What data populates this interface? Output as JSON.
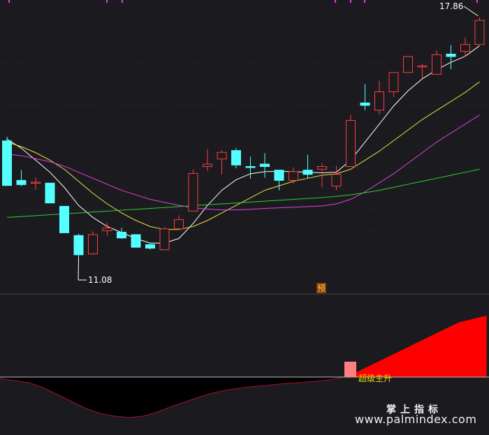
{
  "chart_data": {
    "type": "candlestick",
    "candles": [
      {
        "o": 14.94,
        "h": 15.08,
        "l": 13.46,
        "c": 13.46
      },
      {
        "o": 13.63,
        "h": 13.97,
        "l": 13.44,
        "c": 13.49
      },
      {
        "o": 13.57,
        "h": 13.72,
        "l": 13.32,
        "c": 13.57
      },
      {
        "o": 13.54,
        "h": 13.54,
        "l": 12.88,
        "c": 12.88
      },
      {
        "o": 12.77,
        "h": 12.77,
        "l": 11.89,
        "c": 11.89
      },
      {
        "o": 11.8,
        "h": 11.86,
        "l": 11.08,
        "c": 11.16
      },
      {
        "o": 11.19,
        "h": 11.94,
        "l": 11.16,
        "c": 11.83
      },
      {
        "o": 11.96,
        "h": 12.22,
        "l": 11.8,
        "c": 12.05
      },
      {
        "o": 11.91,
        "h": 12.05,
        "l": 11.69,
        "c": 11.72
      },
      {
        "o": 11.83,
        "h": 11.83,
        "l": 11.41,
        "c": 11.41
      },
      {
        "o": 11.5,
        "h": 11.53,
        "l": 11.33,
        "c": 11.38
      },
      {
        "o": 11.33,
        "h": 12.08,
        "l": 11.33,
        "c": 12.02
      },
      {
        "o": 12.02,
        "h": 12.47,
        "l": 12.0,
        "c": 12.33
      },
      {
        "o": 12.61,
        "h": 13.99,
        "l": 12.61,
        "c": 13.86
      },
      {
        "o": 14.09,
        "h": 14.67,
        "l": 13.94,
        "c": 14.17
      },
      {
        "o": 14.34,
        "h": 14.64,
        "l": 13.83,
        "c": 14.56
      },
      {
        "o": 14.62,
        "h": 14.7,
        "l": 14.03,
        "c": 14.14
      },
      {
        "o": 14.09,
        "h": 14.42,
        "l": 13.69,
        "c": 14.06
      },
      {
        "o": 14.17,
        "h": 14.53,
        "l": 13.72,
        "c": 14.09
      },
      {
        "o": 13.97,
        "h": 13.97,
        "l": 13.3,
        "c": 13.63
      },
      {
        "o": 13.63,
        "h": 14.06,
        "l": 13.52,
        "c": 13.92
      },
      {
        "o": 13.97,
        "h": 14.48,
        "l": 13.69,
        "c": 13.83
      },
      {
        "o": 14.0,
        "h": 14.2,
        "l": 13.41,
        "c": 14.09
      },
      {
        "o": 13.44,
        "h": 14.12,
        "l": 13.3,
        "c": 13.83
      },
      {
        "o": 14.09,
        "h": 15.8,
        "l": 14.09,
        "c": 15.62
      },
      {
        "o": 16.2,
        "h": 16.82,
        "l": 15.96,
        "c": 16.12
      },
      {
        "o": 15.96,
        "h": 16.93,
        "l": 15.82,
        "c": 16.57
      },
      {
        "o": 16.57,
        "h": 17.21,
        "l": 16.4,
        "c": 17.21
      },
      {
        "o": 17.21,
        "h": 17.62,
        "l": 17.21,
        "c": 17.74
      },
      {
        "o": 17.43,
        "h": 17.49,
        "l": 17.01,
        "c": 17.43
      },
      {
        "o": 17.15,
        "h": 17.95,
        "l": 17.15,
        "c": 17.8
      },
      {
        "o": 17.82,
        "h": 18.12,
        "l": 17.32,
        "c": 17.74
      },
      {
        "o": 17.91,
        "h": 18.37,
        "l": 17.74,
        "c": 18.14
      },
      {
        "o": 18.14,
        "h": 19.04,
        "l": 18.14,
        "c": 18.94
      }
    ],
    "ma_lines": [
      {
        "color": "#ffffff",
        "values": [
          15.0,
          14.7,
          14.3,
          13.9,
          13.4,
          12.8,
          12.4,
          12.1,
          11.9,
          11.7,
          11.55,
          11.55,
          11.7,
          12.2,
          12.8,
          13.3,
          13.65,
          13.85,
          13.92,
          13.93,
          13.92,
          13.9,
          13.88,
          13.9,
          14.3,
          14.9,
          15.5,
          16.1,
          16.6,
          17.0,
          17.3,
          17.55,
          17.75,
          18.1
        ]
      },
      {
        "color": "#e8e040",
        "values": [
          14.9,
          14.75,
          14.55,
          14.3,
          14.0,
          13.6,
          13.2,
          12.85,
          12.55,
          12.3,
          12.1,
          12.0,
          12.0,
          12.1,
          12.3,
          12.55,
          12.8,
          13.05,
          13.3,
          13.45,
          13.6,
          13.7,
          13.8,
          13.85,
          14.0,
          14.3,
          14.6,
          14.95,
          15.3,
          15.65,
          15.95,
          16.25,
          16.55,
          16.9
        ]
      },
      {
        "color": "#e040e0",
        "values": [
          14.5,
          14.45,
          14.35,
          14.25,
          14.1,
          13.9,
          13.7,
          13.5,
          13.3,
          13.15,
          13.0,
          12.9,
          12.8,
          12.72,
          12.68,
          12.65,
          12.65,
          12.67,
          12.7,
          12.72,
          12.74,
          12.76,
          12.78,
          12.85,
          13.0,
          13.25,
          13.55,
          13.85,
          14.2,
          14.55,
          14.9,
          15.2,
          15.5,
          15.8
        ]
      },
      {
        "color": "#30d030",
        "values": [
          12.4,
          12.43,
          12.46,
          12.49,
          12.52,
          12.55,
          12.58,
          12.61,
          12.64,
          12.67,
          12.7,
          12.73,
          12.76,
          12.79,
          12.82,
          12.85,
          12.88,
          12.91,
          12.94,
          12.97,
          13.0,
          13.03,
          13.06,
          13.1,
          13.15,
          13.22,
          13.3,
          13.4,
          13.5,
          13.6,
          13.7,
          13.8,
          13.9,
          14.0
        ]
      }
    ],
    "price_range": [
      10.0,
      19.5
    ],
    "annotations": {
      "high_label": "17.86",
      "low_label": "11.08",
      "pre_marker": "预",
      "signal_label": "超级主升"
    },
    "indicator": {
      "baseline": 0,
      "range": [
        -60,
        100
      ],
      "positive_color": "#ff0000",
      "negative_color": "#000000",
      "signal_bar_color": "#ff8080",
      "signal_bar_value": 22,
      "values": [
        -2,
        -5,
        -8,
        -15,
        -25,
        -35,
        -45,
        -52,
        -56,
        -58,
        -56,
        -50,
        -42,
        -35,
        -28,
        -22,
        -18,
        -15,
        -13,
        -11,
        -9,
        -8,
        -6,
        -4,
        0,
        8,
        18,
        28,
        38,
        48,
        58,
        68,
        78,
        88
      ]
    }
  },
  "watermark": {
    "line1": "掌上指标",
    "line2": "www.palmindex.com"
  }
}
